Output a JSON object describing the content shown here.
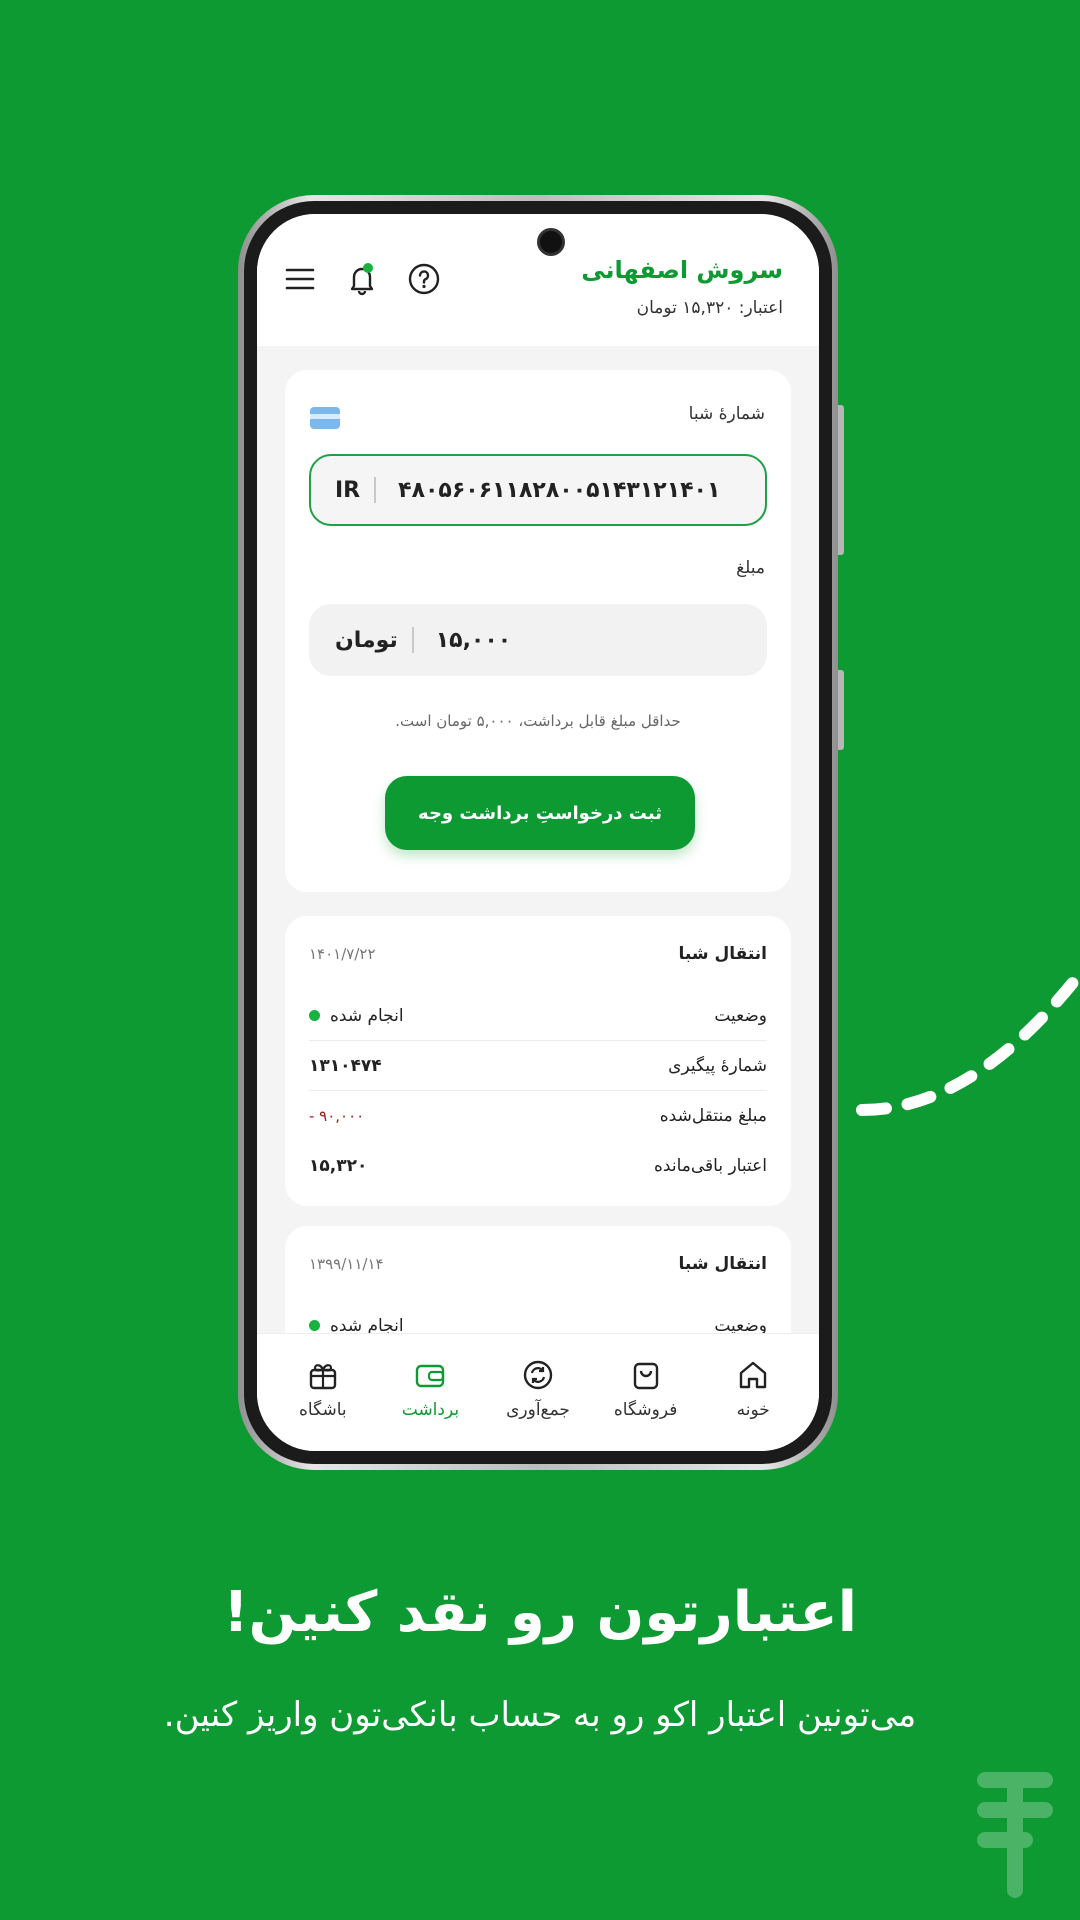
{
  "header": {
    "user_name": "سروش اصفهانی",
    "credit_text": "اعتبار: ۱۵,۳۲۰ تومان"
  },
  "withdraw_form": {
    "sheba_label": "شمارهٔ شبا",
    "iban_prefix": "IR",
    "iban_value": "۴۸۰۵۶۰۶۱۱۸۲۸۰۰۵۱۴۳۱۲۱۴۰۱",
    "amount_label": "مبلغ",
    "currency": "تومان",
    "amount_value": "۱۵,۰۰۰",
    "min_note": "حداقل مبلغ قابل برداشت، ۵,۰۰۰ تومان است.",
    "submit_label": "ثبت درخواستِ برداشت وجه"
  },
  "transactions": [
    {
      "title": "انتقال شبا",
      "date": "۱۴۰۱/۷/۲۲",
      "status_label": "وضعیت",
      "status_value": "انجام شده",
      "tracking_label": "شمارهٔ پیگیری",
      "tracking_value": "۱۳۱۰۴۷۴",
      "amount_label": "مبلغ منتقل‌شده",
      "amount_value": "- ۹۰,۰۰۰",
      "remaining_label": "اعتبار باقی‌مانده",
      "remaining_value": "۱۵,۳۲۰"
    },
    {
      "title": "انتقال شبا",
      "date": "۱۳۹۹/۱۱/۱۴",
      "status_label": "وضعیت",
      "status_value": "انجام شده"
    }
  ],
  "bottom_nav": [
    {
      "label": "خونه",
      "icon": "home-icon"
    },
    {
      "label": "فروشگاه",
      "icon": "shop-bag-icon"
    },
    {
      "label": "جمع‌آوری",
      "icon": "recycle-icon"
    },
    {
      "label": "برداشت",
      "icon": "wallet-icon",
      "active": true
    },
    {
      "label": "باشگاه",
      "icon": "gift-icon"
    }
  ],
  "promo": {
    "headline": "اعتبارتون رو نقد کنین!",
    "subtitle": "می‌تونین اعتبار اکو رو به حساب بانکی‌تون واریز کنین."
  },
  "colors": {
    "brand_green": "#0d9a32",
    "negative_red": "#9b1c1c",
    "status_green": "#17b33f"
  }
}
